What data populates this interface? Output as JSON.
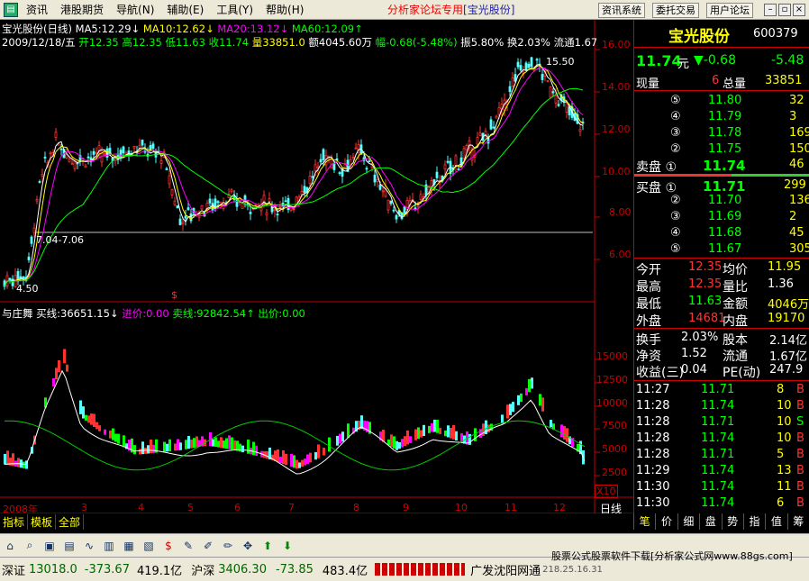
{
  "menu": {
    "items": [
      "资讯",
      "港股期货",
      "导航(N)",
      "辅助(E)",
      "工具(Y)",
      "帮助(H)"
    ],
    "center_text": "分析家论坛专用",
    "center_stock": "[宝光股份]",
    "right_buttons": [
      "资讯系统",
      "委托交易",
      "用户论坛"
    ]
  },
  "kline": {
    "title": "宝光股份(日线)",
    "ma5": "MA5:12.29↓",
    "ma10": "MA10:12.62↓",
    "ma20": "MA20:13.12↓",
    "ma60": "MA60:12.09↑",
    "date": "2009/12/18/五",
    "open": "开12.35",
    "high": "高12.35",
    "low": "低11.63",
    "close": "收11.74",
    "vol": "量33851.0",
    "amount": "额4045.60万",
    "change": "幅-0.68(-5.48%)",
    "amplitude": "振5.80%",
    "turnover": "换2.03%",
    "float": "流通1.67",
    "peak_label": "15.50",
    "low_label": "4.50",
    "ref_label": "7.04-7.06",
    "marker": "$",
    "y_ticks": [
      "16.00",
      "14.00",
      "12.00",
      "10.00",
      "8.00",
      "6.00"
    ]
  },
  "indicator": {
    "name": "与庄舞",
    "buy_line": "买线:36651.15↓",
    "in_price": "进价:0.00",
    "sell_line": "卖线:92842.54↑",
    "out_price": "出价:0.00",
    "y_ticks": [
      "15000",
      "12500",
      "10000",
      "7500",
      "5000",
      "2500"
    ],
    "scale": "X10"
  },
  "months": [
    "2008年",
    "3",
    "4",
    "5",
    "6",
    "7",
    "8",
    "9",
    "10",
    "11",
    "12"
  ],
  "period": "日线",
  "tabs": [
    "指标",
    "模板",
    "全部"
  ],
  "quote": {
    "name": "宝光股份",
    "code": "600379",
    "price": "11.74",
    "unit": "元",
    "change": "▼-0.68",
    "pct": "-5.48",
    "now_vol_label": "现量",
    "now_vol": "6",
    "total_vol_label": "总量",
    "total_vol": "33851",
    "sells": [
      {
        "idx": "⑤",
        "price": "11.80",
        "vol": "32"
      },
      {
        "idx": "④",
        "price": "11.79",
        "vol": "3"
      },
      {
        "idx": "③",
        "price": "11.78",
        "vol": "169"
      },
      {
        "idx": "②",
        "price": "11.75",
        "vol": "150"
      }
    ],
    "sell1_label": "卖盘 ①",
    "sell1_price": "11.74",
    "sell1_vol": "46",
    "buy1_label": "买盘 ①",
    "buy1_price": "11.71",
    "buy1_vol": "299",
    "buys": [
      {
        "idx": "②",
        "price": "11.70",
        "vol": "136"
      },
      {
        "idx": "③",
        "price": "11.69",
        "vol": "2"
      },
      {
        "idx": "④",
        "price": "11.68",
        "vol": "45"
      },
      {
        "idx": "⑤",
        "price": "11.67",
        "vol": "305"
      }
    ],
    "stats": [
      {
        "l1": "今开",
        "v1": "12.35",
        "l2": "均价",
        "v2": "11.95"
      },
      {
        "l1": "最高",
        "v1": "12.35",
        "l2": "量比",
        "v2": "1.36"
      },
      {
        "l1": "最低",
        "v1": "11.63",
        "l2": "金额",
        "v2": "4046万"
      },
      {
        "l1": "外盘",
        "v1": "14681",
        "l2": "内盘",
        "v2": "19170"
      }
    ],
    "stats2": [
      {
        "l1": "换手",
        "v1": "2.03%",
        "l2": "股本",
        "v2": "2.14亿"
      },
      {
        "l1": "净资",
        "v1": "1.52",
        "l2": "流通",
        "v2": "1.67亿"
      },
      {
        "l1": "收益(三)",
        "v1": "0.04",
        "l2": "PE(动)",
        "v2": "247.9"
      }
    ],
    "ticks": [
      {
        "t": "11:27",
        "p": "11.71",
        "v": "8",
        "d": "B"
      },
      {
        "t": "11:28",
        "p": "11.74",
        "v": "10",
        "d": "B"
      },
      {
        "t": "11:28",
        "p": "11.71",
        "v": "10",
        "d": "S"
      },
      {
        "t": "11:28",
        "p": "11.74",
        "v": "10",
        "d": "B"
      },
      {
        "t": "11:28",
        "p": "11.71",
        "v": "5",
        "d": "B"
      },
      {
        "t": "11:29",
        "p": "11.74",
        "v": "13",
        "d": "B"
      },
      {
        "t": "11:30",
        "p": "11.74",
        "v": "11",
        "d": "B"
      },
      {
        "t": "11:30",
        "p": "11.74",
        "v": "6",
        "d": "B"
      }
    ]
  },
  "right_tabs": [
    "笔",
    "价",
    "细",
    "盘",
    "势",
    "指",
    "值",
    "筹"
  ],
  "status": {
    "sz_label": "深证",
    "sz_value": "13018.0",
    "sz_change": "-373.67",
    "sz_amount": "419.1亿",
    "sh_label": "沪深",
    "sh_value": "3406.30",
    "sh_change": "-73.85",
    "sh_amount": "483.4亿",
    "broker": "广发沈阳网通",
    "broker_ip": "218.25.16.31",
    "footer_text": "股票公式股票软件下载[分析家公式网www.88gs.com]"
  },
  "colors": {
    "up": "#ff3232",
    "down": "#54ffff",
    "ma5": "#ffffff",
    "ma10": "#ffff00",
    "ma20": "#ff00ff",
    "ma60": "#00ff00",
    "grid": "#c00000"
  }
}
